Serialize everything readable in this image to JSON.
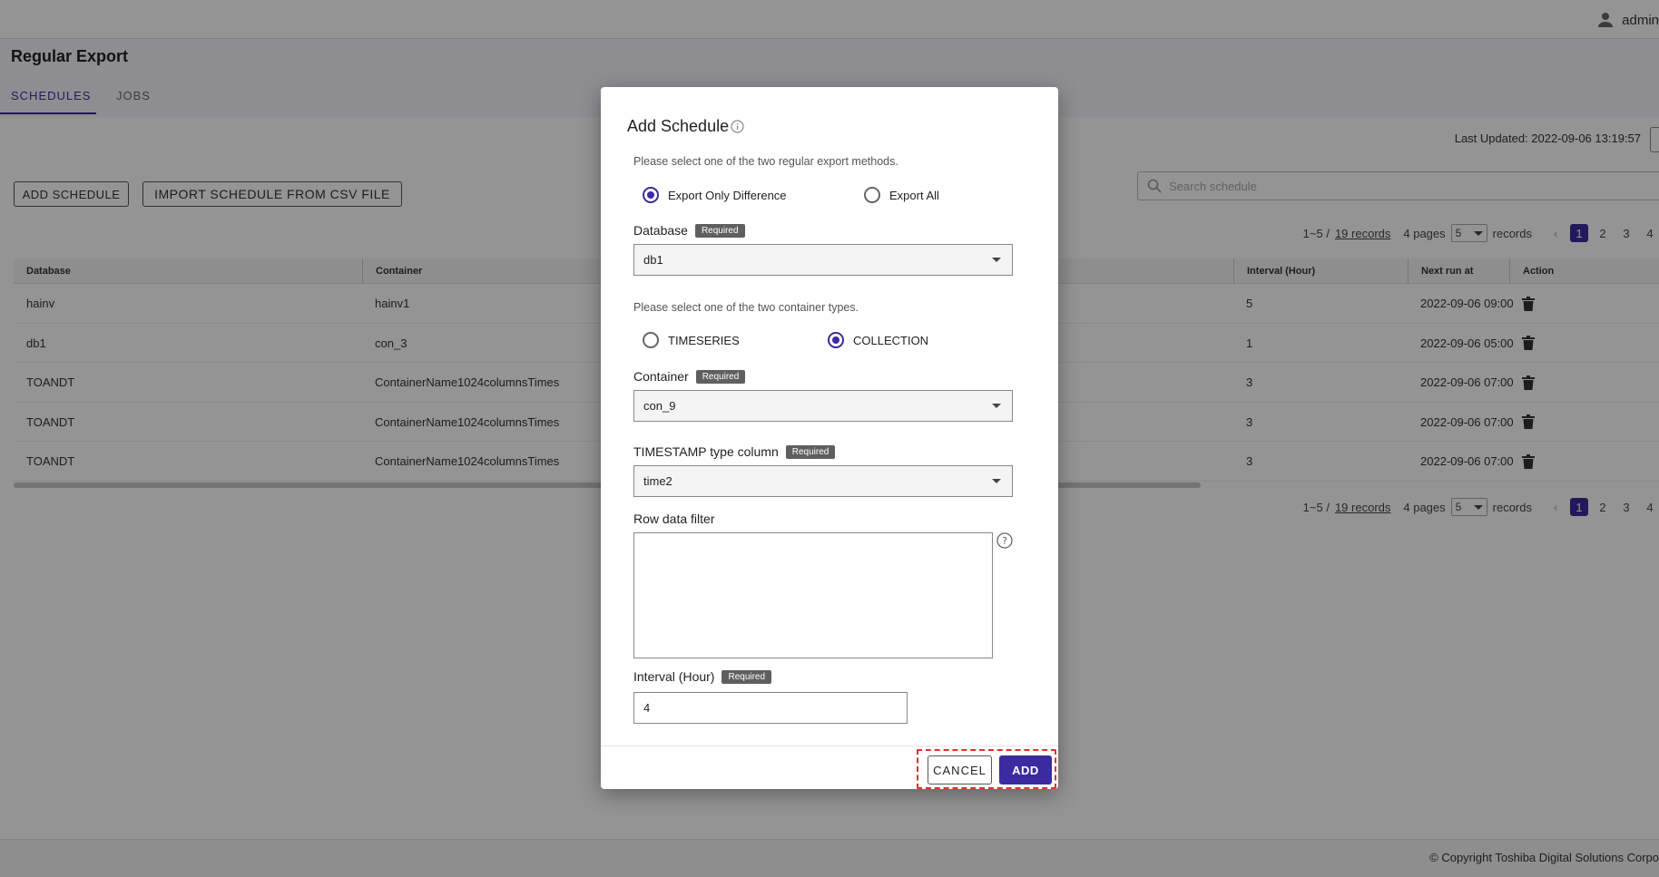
{
  "header": {
    "user_name": "admin",
    "user_icon": "user-icon"
  },
  "page": {
    "title": "Regular Export",
    "tabs": [
      {
        "label": "SCHEDULES",
        "active": true
      },
      {
        "label": "JOBS",
        "active": false
      }
    ],
    "last_updated": "Last Updated: 2022-09-06 13:19:57"
  },
  "toolbar": {
    "add_schedule_label": "ADD SCHEDULE",
    "import_label": "IMPORT SCHEDULE FROM CSV FILE",
    "search_placeholder": "Search schedule"
  },
  "pagination": {
    "range": "1~5 /",
    "records_link": "19 records",
    "pages": "4 pages",
    "per_page": "5",
    "records_word": "records",
    "page_numbers": [
      "1",
      "2",
      "3",
      "4"
    ],
    "active_page": "1"
  },
  "table": {
    "columns": [
      "Database",
      "Container",
      "Interval (Hour)",
      "Next run at",
      "Action"
    ],
    "rows": [
      {
        "database": "hainv",
        "container": "hainv1",
        "interval": "5",
        "next_run": "2022-09-06 09:00"
      },
      {
        "database": "db1",
        "container": "con_3",
        "interval": "1",
        "next_run": "2022-09-06 05:00"
      },
      {
        "database": "TOANDT",
        "container": "ContainerName1024columnsTimes",
        "interval": "3",
        "next_run": "2022-09-06 07:00"
      },
      {
        "database": "TOANDT",
        "container": "ContainerName1024columnsTimes",
        "interval": "3",
        "next_run": "2022-09-06 07:00"
      },
      {
        "database": "TOANDT",
        "container": "ContainerName1024columnsTimes",
        "interval": "3",
        "next_run": "2022-09-06 07:00"
      }
    ]
  },
  "footer": {
    "copyright": "© Copyright Toshiba Digital Solutions Corpo"
  },
  "dialog": {
    "title": "Add Schedule",
    "method_hint": "Please select one of the two regular export methods.",
    "methods": [
      {
        "label": "Export Only Difference",
        "checked": true
      },
      {
        "label": "Export All",
        "checked": false
      }
    ],
    "database_label": "Database",
    "required_label": "Required",
    "database_value": "db1",
    "container_type_hint": "Please select one of the two container types.",
    "container_types": [
      {
        "label": "TIMESERIES",
        "checked": false
      },
      {
        "label": "COLLECTION",
        "checked": true
      }
    ],
    "container_label": "Container",
    "container_value": "con_9",
    "timestamp_label": "TIMESTAMP type column",
    "timestamp_value": "time2",
    "row_filter_label": "Row data filter",
    "row_filter_value": "",
    "interval_label": "Interval (Hour)",
    "interval_value": "4",
    "cancel_label": "CANCEL",
    "add_label": "ADD"
  },
  "colors": {
    "accent": "#3a2c9e",
    "highlight": "#e0302a",
    "required_badge": "#5f5f5f"
  }
}
